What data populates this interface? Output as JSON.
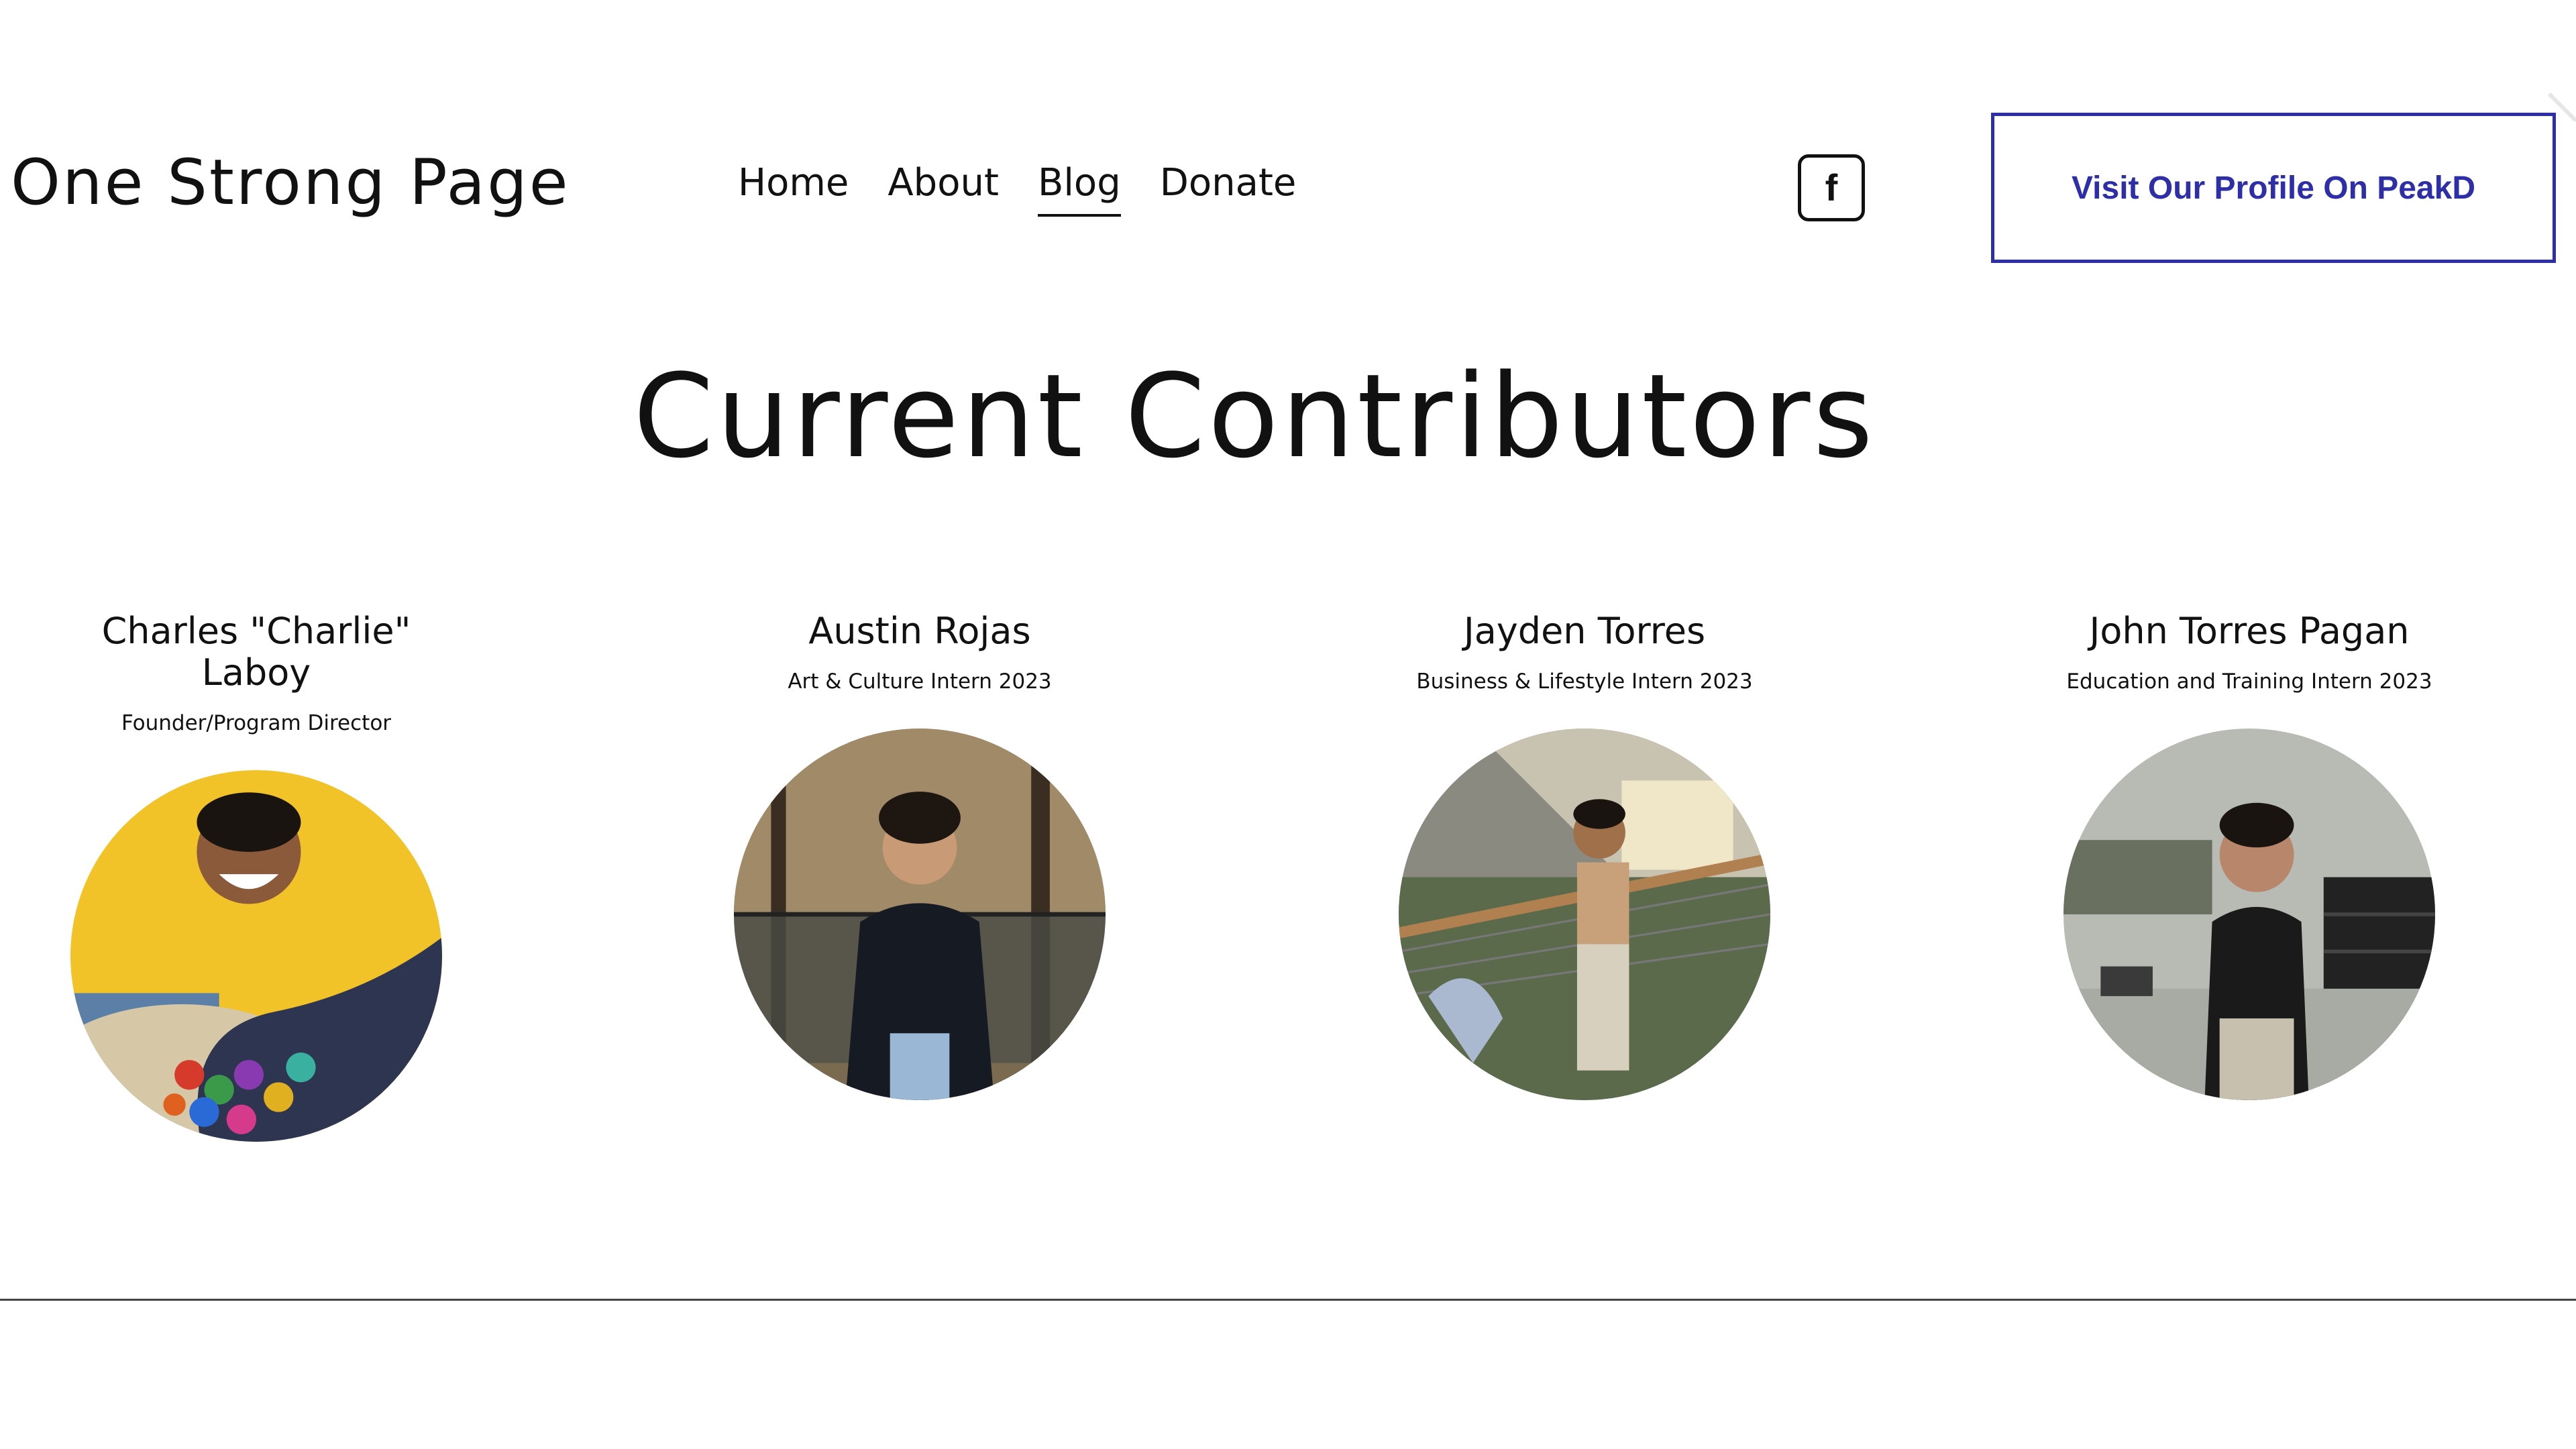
{
  "header": {
    "site_title": "One Strong Page",
    "nav": [
      {
        "label": "Home",
        "active": false
      },
      {
        "label": "About",
        "active": false
      },
      {
        "label": "Blog",
        "active": true
      },
      {
        "label": "Donate",
        "active": false
      }
    ],
    "facebook_icon": "facebook-icon",
    "facebook_glyph": "f",
    "cta_label": "Visit Our Profile On PeakD",
    "accent_color": "#2e2ea8"
  },
  "main": {
    "heading": "Current Contributors",
    "contributors": [
      {
        "name": "Charles \"Charlie\" Laboy",
        "role": "Founder/Program Director"
      },
      {
        "name": "Austin Rojas",
        "role": "Art & Culture Intern 2023"
      },
      {
        "name": "Jayden Torres",
        "role": "Business & Lifestyle Intern 2023"
      },
      {
        "name": "John Torres Pagan",
        "role": "Education and Training Intern 2023"
      }
    ]
  }
}
